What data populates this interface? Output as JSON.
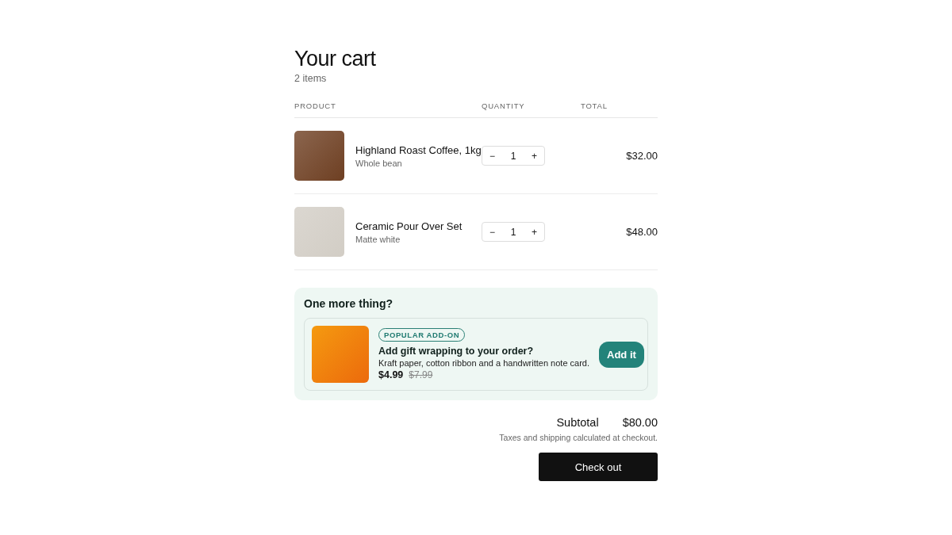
{
  "title": "Your cart",
  "item_count": "2 items",
  "columns": [
    "PRODUCT",
    "QUANTITY",
    "TOTAL"
  ],
  "items": [
    {
      "name": "Highland Roast Coffee, 1kg",
      "variant": "Whole bean",
      "color": "#6e3f22",
      "decrease": "−",
      "quantity": "1",
      "increase": "+",
      "total": "$32.00"
    },
    {
      "name": "Ceramic Pour Over Set",
      "variant": "Matte white",
      "color": "#d2cdc5",
      "decrease": "−",
      "quantity": "1",
      "increase": "+",
      "total": "$48.00"
    }
  ],
  "upsell": {
    "heading": "One more thing?",
    "badge": "POPULAR ADD-ON",
    "title": "Add gift wrapping to your order?",
    "description": "Kraft paper, cotton ribbon and a handwritten note card.",
    "price": "$4.99",
    "original_price": "$7.99",
    "button": "Add it",
    "color": "#ec6a0c"
  },
  "summary": {
    "label": "Subtotal",
    "value": "$80.00",
    "note": "Taxes and shipping calculated at checkout.",
    "button": "Check out"
  }
}
